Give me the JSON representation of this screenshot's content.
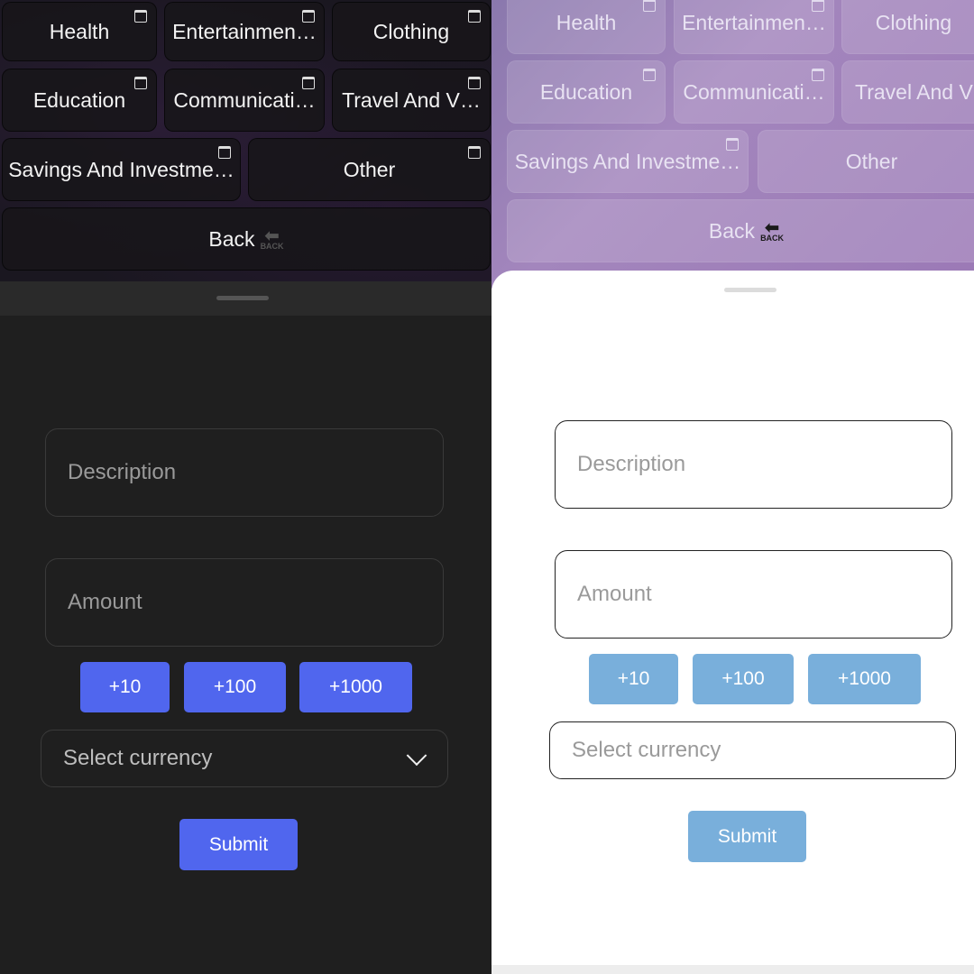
{
  "categories": [
    "Health",
    "Entertainmen…",
    "Clothing",
    "Education",
    "Communicati…",
    "Travel And V…",
    "Savings And Investme…",
    "Other"
  ],
  "back": {
    "label": "Back",
    "icon_text": "BACK"
  },
  "form": {
    "description_placeholder": "Description",
    "amount_placeholder": "Amount",
    "quick_adds": [
      "+10",
      "+100",
      "+1000"
    ],
    "currency_placeholder": "Select currency",
    "submit_label": "Submit"
  },
  "themes": {
    "dark": {
      "accent": "#5066ee",
      "background": "#1f1f1f"
    },
    "light": {
      "accent": "#79afdb",
      "background": "#ffffff",
      "header": "#9b79b6"
    }
  }
}
